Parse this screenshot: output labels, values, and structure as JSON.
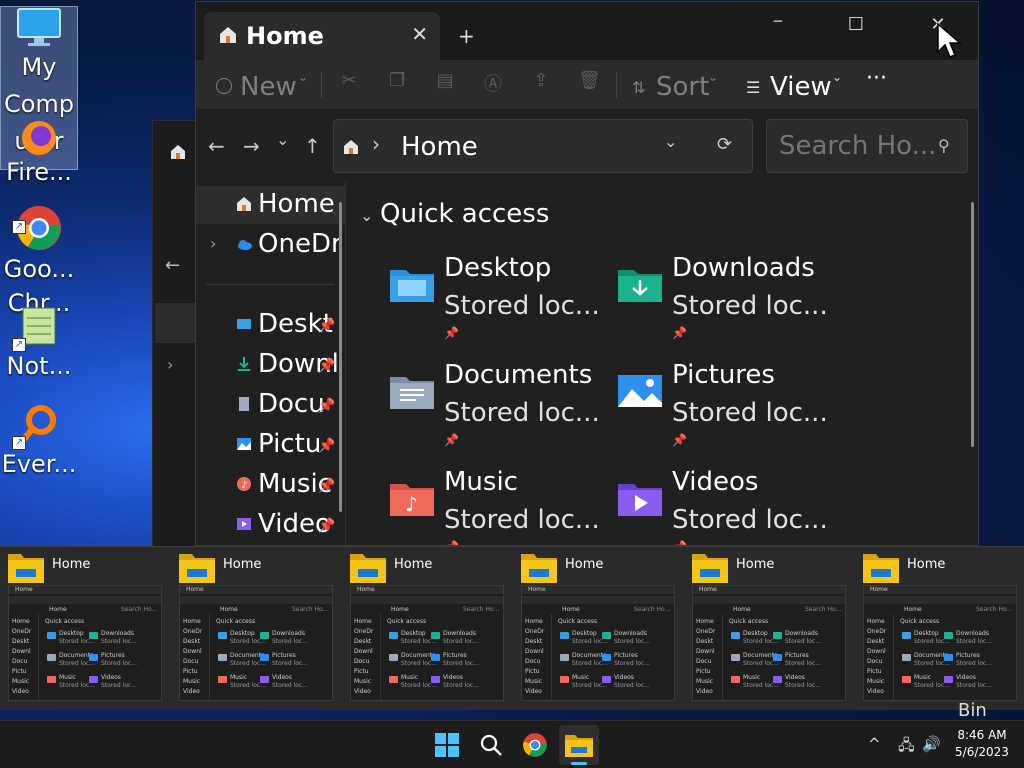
{
  "desktop": {
    "icons": [
      {
        "label": "My\nComp\nuter",
        "icon": "monitor-icon"
      },
      {
        "label": "Fire...",
        "icon": "firefox-icon"
      },
      {
        "label": "Goo...\nChr...",
        "icon": "chrome-icon"
      },
      {
        "label": "Not...",
        "icon": "notepad-icon"
      },
      {
        "label": "Ever...",
        "icon": "everything-search-icon"
      }
    ]
  },
  "window": {
    "tab_label": "Home",
    "tab_close": "✕",
    "new_tab": "+",
    "controls": {
      "minimize": "─",
      "maximize": "☐",
      "close": "✕"
    },
    "toolbar": {
      "new_label": "New",
      "sort_label": "Sort",
      "view_label": "View",
      "more": "···"
    },
    "nav": {
      "back": "←",
      "forward": "→",
      "recent": "⌄",
      "up": "↑",
      "refresh": "⟳"
    },
    "address": {
      "path": "Home",
      "separator": "›",
      "dropdown": "⌄"
    },
    "search": {
      "placeholder": "Search Ho..."
    },
    "nav_pane": {
      "items": [
        {
          "label": "Home",
          "icon": "home-icon",
          "selected": true
        },
        {
          "label": "OneDr",
          "icon": "onedrive-icon",
          "expandable": true
        },
        {
          "label": "Deskt",
          "icon": "desktop-icon",
          "pinned": true
        },
        {
          "label": "Downl",
          "icon": "downloads-icon",
          "pinned": true
        },
        {
          "label": "Docu",
          "icon": "documents-icon",
          "pinned": true
        },
        {
          "label": "Pictu",
          "icon": "pictures-icon",
          "pinned": true
        },
        {
          "label": "Music",
          "icon": "music-icon",
          "pinned": true
        },
        {
          "label": "Video",
          "icon": "videos-icon",
          "pinned": true
        }
      ]
    },
    "quick_access": {
      "title": "Quick access",
      "items": [
        {
          "name": "Desktop",
          "sub": "Stored loc...",
          "icon": "desktop-folder-icon",
          "color": "#3aa0e6"
        },
        {
          "name": "Downloads",
          "sub": "Stored loc...",
          "icon": "downloads-folder-icon",
          "color": "#1bb38f"
        },
        {
          "name": "Documents",
          "sub": "Stored loc...",
          "icon": "documents-folder-icon",
          "color": "#9aa9bd"
        },
        {
          "name": "Pictures",
          "sub": "Stored loc...",
          "icon": "pictures-folder-icon",
          "color": "#2d8ff0"
        },
        {
          "name": "Music",
          "sub": "Stored loc...",
          "icon": "music-folder-icon",
          "color": "#f06a5a"
        },
        {
          "name": "Videos",
          "sub": "Stored loc...",
          "icon": "videos-folder-icon",
          "color": "#8a5cf0"
        }
      ]
    }
  },
  "thumbnails": [
    {
      "title": "Home"
    },
    {
      "title": "Home"
    },
    {
      "title": "Home"
    },
    {
      "title": "Home"
    },
    {
      "title": "Home"
    },
    {
      "title": "Home"
    }
  ],
  "thumbnail_preview": {
    "tab": "Home",
    "address": "Home",
    "qa_title": "Quick access",
    "nav": [
      "Home",
      "OneDr",
      "Deskt",
      "Downl",
      "Docu",
      "Pictu",
      "Music",
      "Video"
    ],
    "tiles": [
      {
        "name": "Desktop",
        "sub": "Stored loc..."
      },
      {
        "name": "Downloads",
        "sub": "Stored loc..."
      },
      {
        "name": "Documents",
        "sub": "Stored loc..."
      },
      {
        "name": "Pictures",
        "sub": "Stored loc..."
      },
      {
        "name": "Music",
        "sub": "Stored loc..."
      },
      {
        "name": "Videos",
        "sub": "Stored loc..."
      }
    ]
  },
  "desktop_peek_text": "Bin",
  "taskbar": {
    "apps": [
      "start-icon",
      "search-icon",
      "chrome-icon",
      "file-explorer-icon"
    ],
    "tray_chevron": "^",
    "time": "8:46 AM",
    "date": "5/6/2023"
  },
  "colors": {
    "accent": "#4cc2ff",
    "folder_yellow": "#f5c518",
    "window_bg": "#202020"
  }
}
